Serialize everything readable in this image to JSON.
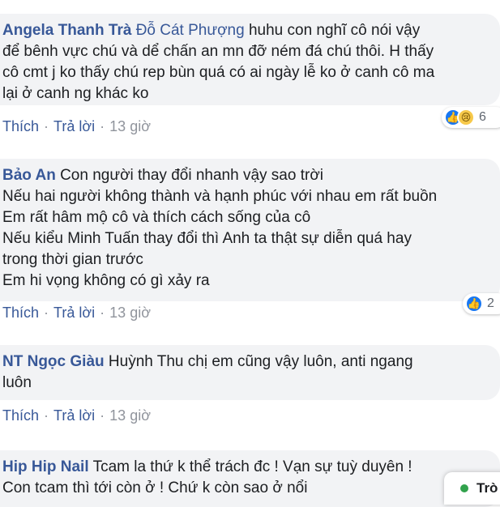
{
  "actions": {
    "like": "Thích",
    "reply": "Trả lời",
    "sep": "·",
    "time": "13 giờ"
  },
  "comments": [
    {
      "author": "Angela Thanh Trà",
      "mention": "Đỗ Cát Phượng",
      "lines": [
        "huhu con nghĩ cô nói vậy",
        "để bênh vực chú và dể chấn an mn đỡ ném đá chú thôi. H thấy",
        "cô cmt j ko thấy chú rep bùn quá có ai ngày lễ ko ở canh cô ma",
        "lại ở canh ng khác ko"
      ],
      "reaction_count": "6"
    },
    {
      "author": "Bảo An",
      "lines": [
        "Con người thay đổi nhanh vậy sao trời",
        "Nếu hai người không thành và hạnh phúc với nhau em rất buồn",
        "Em rất hâm mộ cô và thích cách sống của cô",
        "Nếu kiểu Minh Tuấn thay đổi thì Anh ta thật sự diễn quá hay",
        "trong thời gian trước",
        "Em hi vọng không có gì xảy ra"
      ],
      "reaction_count": "2"
    },
    {
      "author": "NT Ngọc Giàu",
      "lines": [
        "Huỳnh Thu chị em cũng vậy luôn, anti ngang",
        "luôn"
      ]
    },
    {
      "author": "Hip Hip Nail",
      "lines": [
        "Tcam la thứ k thể trách đc ! Vạn sự tuỳ duyên !",
        "Con tcam thì tới còn ở ! Chứ k còn sao ở nổi"
      ]
    }
  ],
  "chat": {
    "label": "Trò"
  },
  "colors": {
    "link": "#385898",
    "bubble": "#f2f3f5",
    "meta": "#90949c",
    "like": "#1877f2",
    "online": "#31a24c"
  }
}
